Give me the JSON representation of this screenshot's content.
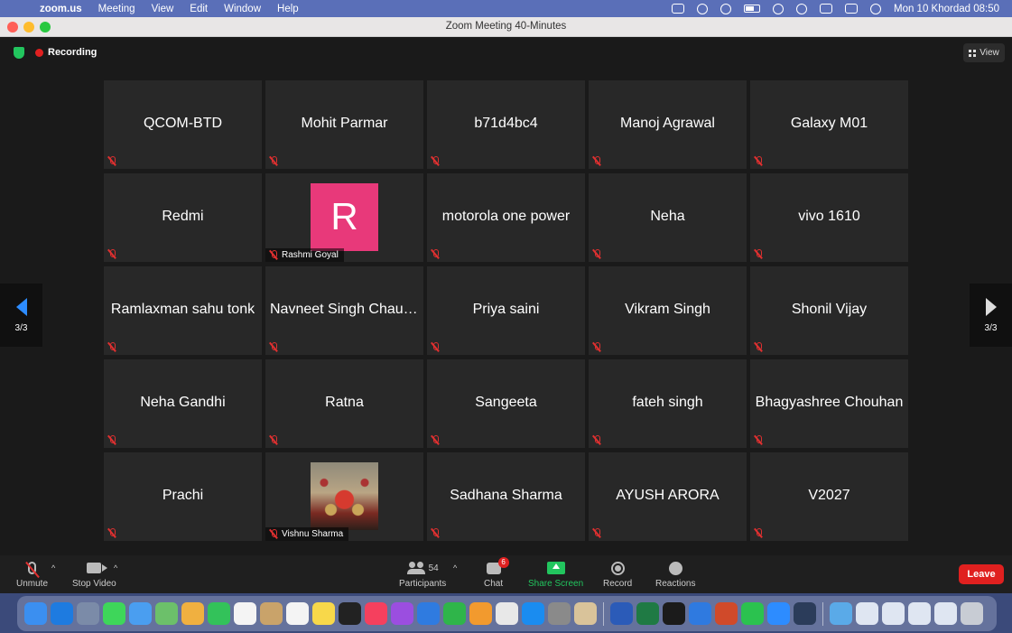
{
  "menubar": {
    "app_name": "zoom.us",
    "menus": [
      "Meeting",
      "View",
      "Edit",
      "Window",
      "Help"
    ],
    "clock": "Mon 10 Khordad  08:50"
  },
  "window": {
    "title": "Zoom Meeting  40-Minutes"
  },
  "meeting": {
    "recording_label": "Recording",
    "view_label": "View",
    "page_indicator": "3/3"
  },
  "participants": [
    {
      "name": "QCOM-BTD",
      "type": "name"
    },
    {
      "name": "Mohit Parmar",
      "type": "name"
    },
    {
      "name": "b71d4bc4",
      "type": "name"
    },
    {
      "name": "Manoj Agrawal",
      "type": "name"
    },
    {
      "name": "Galaxy M01",
      "type": "name"
    },
    {
      "name": "Redmi",
      "type": "name"
    },
    {
      "name": "Rashmi Goyal",
      "type": "avatar",
      "initial": "R"
    },
    {
      "name": "motorola one power",
      "type": "name"
    },
    {
      "name": "Neha",
      "type": "name"
    },
    {
      "name": "vivo 1610",
      "type": "name"
    },
    {
      "name": "Ramlaxman sahu tonk",
      "type": "name"
    },
    {
      "name": "Navneet Singh Chaud...",
      "type": "name"
    },
    {
      "name": "Priya saini",
      "type": "name"
    },
    {
      "name": "Vikram Singh",
      "type": "name"
    },
    {
      "name": "Shonil Vijay",
      "type": "name"
    },
    {
      "name": "Neha Gandhi",
      "type": "name"
    },
    {
      "name": "Ratna",
      "type": "name"
    },
    {
      "name": "Sangeeta",
      "type": "name"
    },
    {
      "name": "fateh singh",
      "type": "name"
    },
    {
      "name": "Bhagyashree Chouhan",
      "type": "name"
    },
    {
      "name": "Prachi",
      "type": "name"
    },
    {
      "name": "Vishnu Sharma",
      "type": "photo"
    },
    {
      "name": "Sadhana Sharma",
      "type": "name"
    },
    {
      "name": "AYUSH ARORA",
      "type": "name"
    },
    {
      "name": "V2027",
      "type": "name"
    }
  ],
  "toolbar": {
    "unmute_label": "Unmute",
    "stop_video_label": "Stop Video",
    "participants_label": "Participants",
    "participants_count": "54",
    "chat_label": "Chat",
    "chat_badge": "6",
    "share_label": "Share Screen",
    "record_label": "Record",
    "reactions_label": "Reactions",
    "leave_label": "Leave"
  },
  "colors": {
    "accent_blue": "#2d8cff",
    "share_green": "#22c55e",
    "leave_red": "#e0201f",
    "avatar_pink": "#e8397a",
    "tile_bg": "#282828"
  },
  "dock_icons": [
    {
      "name": "finder-icon",
      "color": "#3b8ff0"
    },
    {
      "name": "safari-icon",
      "color": "#1e7be0"
    },
    {
      "name": "launchpad-icon",
      "color": "#7b8ba8"
    },
    {
      "name": "messages-icon",
      "color": "#3ed65a"
    },
    {
      "name": "mail-icon",
      "color": "#4a9ef0"
    },
    {
      "name": "maps-icon",
      "color": "#6cc06a"
    },
    {
      "name": "photos-icon",
      "color": "#f0b040"
    },
    {
      "name": "facetime-icon",
      "color": "#33c25a"
    },
    {
      "name": "calendar-icon",
      "color": "#f4f4f4"
    },
    {
      "name": "contacts-icon",
      "color": "#c9a36a"
    },
    {
      "name": "reminders-icon",
      "color": "#f4f4f4"
    },
    {
      "name": "notes-icon",
      "color": "#f8d84a"
    },
    {
      "name": "apple-tv-icon",
      "color": "#222222"
    },
    {
      "name": "music-icon",
      "color": "#f5405e"
    },
    {
      "name": "podcasts-icon",
      "color": "#9b4ee0"
    },
    {
      "name": "keynote-icon",
      "color": "#2f7be0"
    },
    {
      "name": "numbers-icon",
      "color": "#2fb54a"
    },
    {
      "name": "pages-icon",
      "color": "#f29a2e"
    },
    {
      "name": "chrome-icon",
      "color": "#e8e8e8"
    },
    {
      "name": "app-store-icon",
      "color": "#1a8cf0"
    },
    {
      "name": "system-preferences-icon",
      "color": "#8a8a8a"
    },
    {
      "name": "preview-icon",
      "color": "#d9c39a"
    },
    {
      "name": "word-icon",
      "color": "#2b5bb8"
    },
    {
      "name": "excel-icon",
      "color": "#1f7a44"
    },
    {
      "name": "activity-monitor-icon",
      "color": "#1b1b1b"
    },
    {
      "name": "bluetooth-icon",
      "color": "#2f7ae0"
    },
    {
      "name": "powerpoint-icon",
      "color": "#d04a2a"
    },
    {
      "name": "whatsapp-icon",
      "color": "#2bc24f"
    },
    {
      "name": "zoom-icon",
      "color": "#2d8cff"
    },
    {
      "name": "quicktime-icon",
      "color": "#2b3c5a"
    },
    {
      "name": "folder-icon",
      "color": "#5aaae8"
    },
    {
      "name": "window-thumb-1-icon",
      "color": "#dfe6f2"
    },
    {
      "name": "window-thumb-2-icon",
      "color": "#dfe6f2"
    },
    {
      "name": "window-thumb-3-icon",
      "color": "#dfe6f2"
    },
    {
      "name": "window-thumb-4-icon",
      "color": "#dfe6f2"
    },
    {
      "name": "trash-icon",
      "color": "#c8ccd4"
    }
  ]
}
